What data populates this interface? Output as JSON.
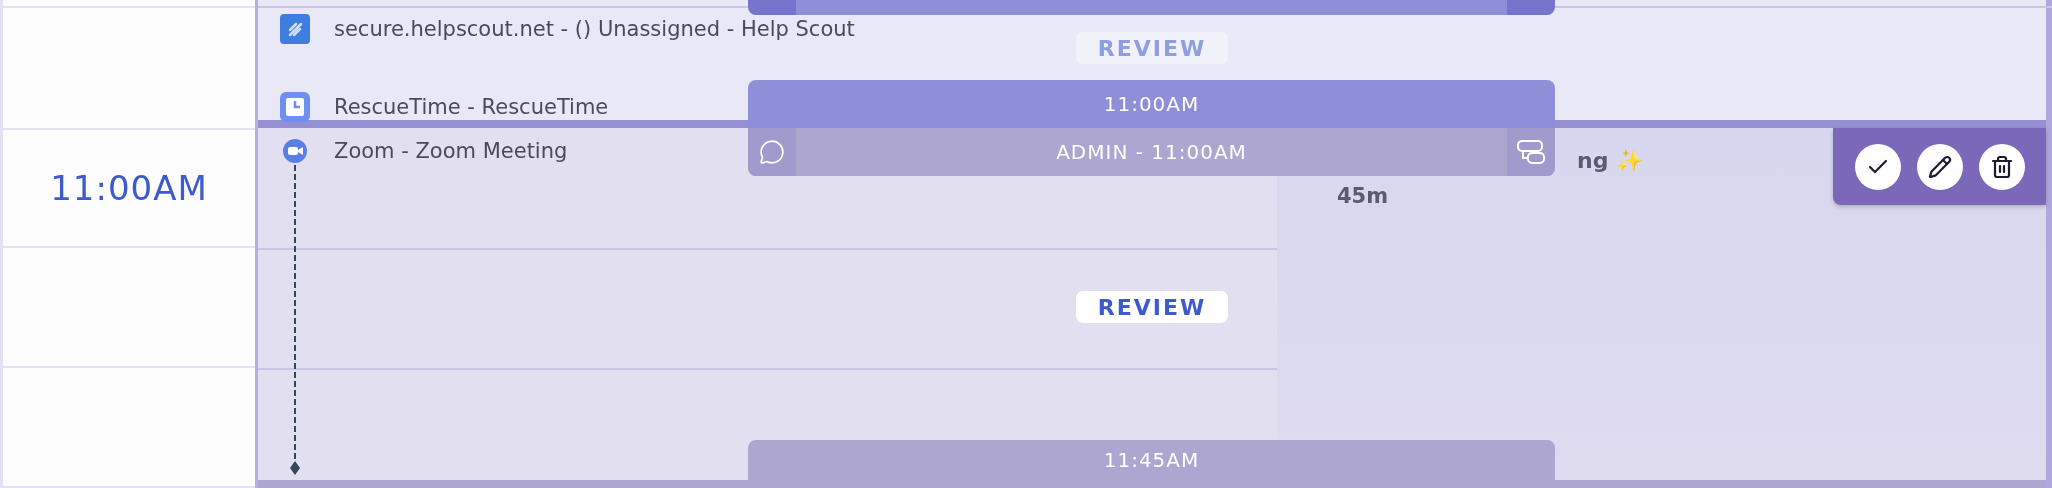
{
  "time_label": "11:00AM",
  "activities": [
    {
      "kind": "slashes",
      "title": "secure.helpscout.net - () Unassigned - Help Scout"
    },
    {
      "kind": "clock",
      "title": "RescueTime - RescueTime"
    },
    {
      "kind": "camera",
      "title": "Zoom - Zoom Meeting"
    }
  ],
  "review_badges": [
    {
      "label": "REVIEW",
      "faded": true
    },
    {
      "label": "REVIEW",
      "faded": false
    }
  ],
  "event_card": {
    "time": "11:00AM",
    "title": "ADMIN - 11:00AM"
  },
  "next_card": {
    "time": "11:45AM"
  },
  "detail": {
    "title": "ng ✨",
    "duration": "45m"
  },
  "actions": [
    {
      "kind": "complete"
    },
    {
      "kind": "edit"
    },
    {
      "kind": "delete"
    }
  ]
}
